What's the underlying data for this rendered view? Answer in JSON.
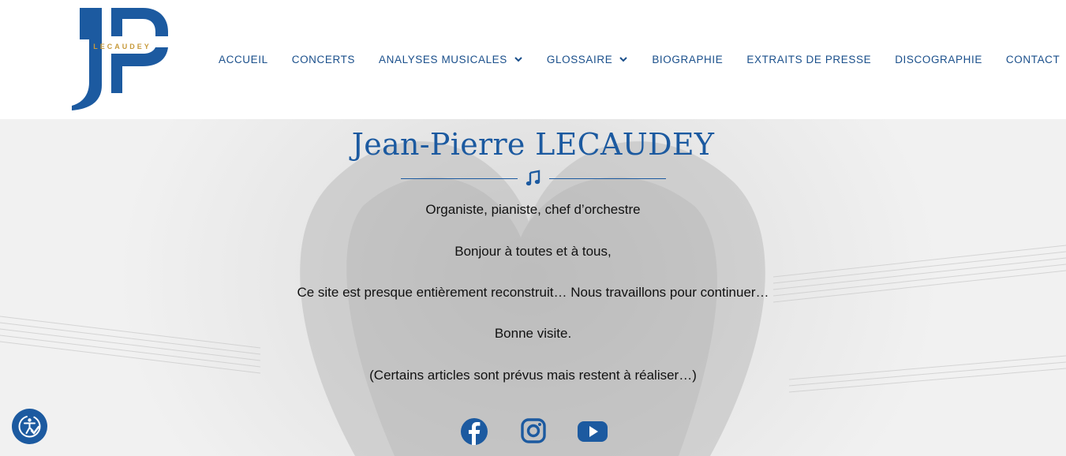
{
  "brand": {
    "logo_text": "JP",
    "logo_subtext": "LECAUDEY",
    "primary_color": "#1c5aa0",
    "accent_color": "#c79a3b"
  },
  "nav": {
    "items": [
      {
        "label": "ACCUEIL",
        "has_dropdown": false
      },
      {
        "label": "CONCERTS",
        "has_dropdown": false
      },
      {
        "label": "ANALYSES MUSICALES",
        "has_dropdown": true
      },
      {
        "label": "GLOSSAIRE",
        "has_dropdown": true
      },
      {
        "label": "BIOGRAPHIE",
        "has_dropdown": false
      },
      {
        "label": "EXTRAITS DE PRESSE",
        "has_dropdown": false
      },
      {
        "label": "DISCOGRAPHIE",
        "has_dropdown": false
      },
      {
        "label": "CONTACT",
        "has_dropdown": false
      }
    ]
  },
  "hero": {
    "title": "Jean-Pierre LECAUDEY",
    "divider_icon": "music-note-icon",
    "lines": [
      "Organiste, pianiste, chef d’orchestre",
      "Bonjour à toutes et à tous,",
      "Ce site est presque entièrement reconstruit… Nous travaillons pour continuer…",
      "Bonne visite.",
      "(Certains articles sont prévus mais restent à réaliser…)"
    ]
  },
  "social": {
    "icons": [
      "facebook-icon",
      "instagram-icon",
      "youtube-icon"
    ]
  },
  "accessibility": {
    "icon": "accessibility-icon"
  }
}
